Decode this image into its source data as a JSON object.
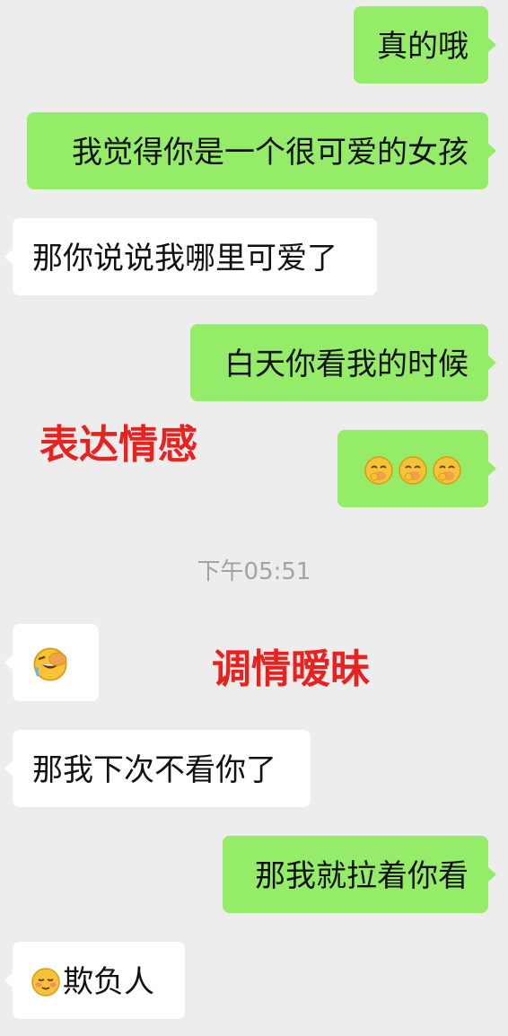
{
  "messages": [
    {
      "side": "right",
      "text": "真的哦"
    },
    {
      "side": "right",
      "text": "我觉得你是一个很可爱的女孩"
    },
    {
      "side": "left",
      "text": "那你说说我哪里可爱了"
    },
    {
      "side": "right",
      "text": "白天你看我的时候"
    },
    {
      "side": "right",
      "emojis": [
        "giggle-emoji",
        "giggle-emoji",
        "giggle-emoji"
      ]
    },
    {
      "side": "left",
      "emojis": [
        "facepalm-laugh-emoji"
      ]
    },
    {
      "side": "left",
      "text": "那我下次不看你了"
    },
    {
      "side": "right",
      "text": "那我就拉着你看"
    },
    {
      "side": "left",
      "text": "欺负人",
      "emojis": [
        "blushing-smile-emoji"
      ]
    }
  ],
  "timestamp": "下午05:51",
  "annotations": {
    "first": "表达情感",
    "second": "调情暧昧",
    "color": "#e8231f"
  },
  "colors": {
    "background": "#ededed",
    "sent_bubble": "#95ec69",
    "received_bubble": "#ffffff"
  }
}
